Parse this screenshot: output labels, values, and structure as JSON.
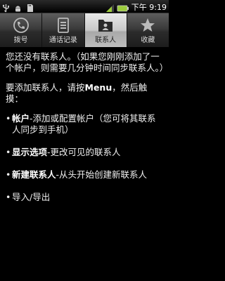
{
  "status_bar": {
    "time": "下午 9:19",
    "left_icons": [
      "usb-icon",
      "android-debug-icon",
      "sd-card-icon"
    ],
    "right_icons": [
      "signal-icon",
      "battery-icon"
    ]
  },
  "tabs": [
    {
      "label": "拨号",
      "icon": "phone-icon",
      "active": false
    },
    {
      "label": "通话记录",
      "icon": "call-log-icon",
      "active": false
    },
    {
      "label": "联系人",
      "icon": "contacts-icon",
      "active": true
    },
    {
      "label": "收藏",
      "icon": "star-icon",
      "active": false
    }
  ],
  "content": {
    "intro": "您还没有联系人。（如果您刚刚添加了一个帐户，则需要几分钟时间同步联系人。）",
    "instruction_prefix": "要添加联系人，请按",
    "instruction_menu": "Menu",
    "instruction_suffix": "，然后触摸：",
    "items": [
      {
        "title": "帐户",
        "desc": "-添加或配置帐户（您可将其联系人同步到手机）"
      },
      {
        "title": "显示选项",
        "desc": "-更改可见的联系人"
      },
      {
        "title": "新建联系人",
        "desc": "-从头开始创建新联系人"
      },
      {
        "title": "导入/导出",
        "desc": ""
      }
    ]
  },
  "colors": {
    "background": "#000000",
    "tab_active": "#c9c9c9",
    "tab_inactive": "#3b3b3b",
    "text": "#f0f0f0"
  }
}
